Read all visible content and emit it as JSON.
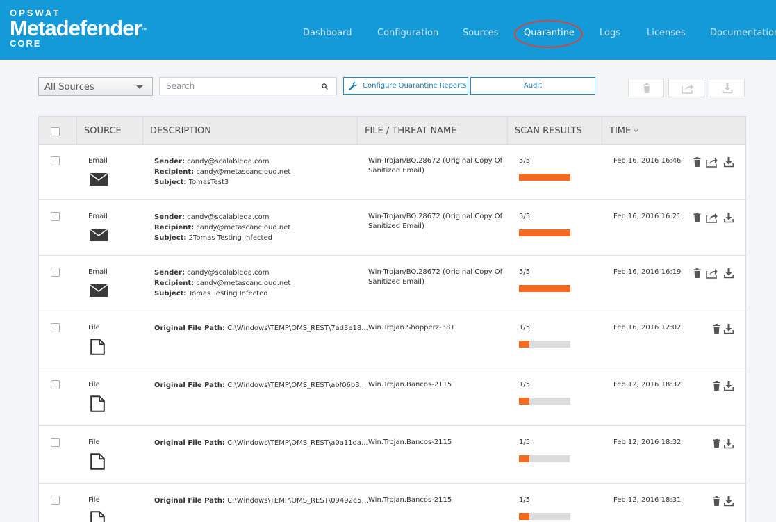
{
  "header": {
    "brand": "OPSWAT",
    "product": "Metadefender",
    "trademark": "™",
    "edition": "CORE",
    "nav": [
      {
        "label": "Dashboard",
        "active": false
      },
      {
        "label": "Configuration",
        "active": false
      },
      {
        "label": "Sources",
        "active": false
      },
      {
        "label": "Quarantine",
        "active": true
      },
      {
        "label": "Logs",
        "active": false
      },
      {
        "label": "Licenses",
        "active": false
      },
      {
        "label": "Documentation",
        "active": false
      }
    ]
  },
  "toolbar": {
    "source_filter": "All Sources",
    "search_placeholder": "Search",
    "configure_reports_label": "Configure Quarantine Reports",
    "audit_label": "Audit",
    "bulk_actions": [
      "trash-icon",
      "share-icon",
      "download-icon"
    ]
  },
  "table": {
    "columns": [
      "SOURCE",
      "DESCRIPTION",
      "FILE / THREAT NAME",
      "SCAN RESULTS",
      "TIME"
    ],
    "rows": [
      {
        "source": "Email",
        "icon": "envelope-icon",
        "details": [
          {
            "label": "Sender:",
            "value": "candy@scalableqa.com"
          },
          {
            "label": "Recipient:",
            "value": "candy@metascancloud.net"
          },
          {
            "label": "Subject:",
            "value": "TomasTest3"
          }
        ],
        "threat": "Win-Trojan/BO.28672 (Original Copy Of Sanitized Email)",
        "score": "5/5",
        "detection_ratio": 1.0,
        "time": "Feb 16, 2016 16:46",
        "actions": [
          "trash-icon",
          "share-icon",
          "download-icon"
        ]
      },
      {
        "source": "Email",
        "icon": "envelope-icon",
        "details": [
          {
            "label": "Sender:",
            "value": "candy@scalableqa.com"
          },
          {
            "label": "Recipient:",
            "value": "candy@metascancloud.net"
          },
          {
            "label": "Subject:",
            "value": "2Tomas Testing Infected"
          }
        ],
        "threat": "Win-Trojan/BO.28672 (Original Copy Of Sanitized Email)",
        "score": "5/5",
        "detection_ratio": 1.0,
        "time": "Feb 16, 2016 16:21",
        "actions": [
          "trash-icon",
          "share-icon",
          "download-icon"
        ]
      },
      {
        "source": "Email",
        "icon": "envelope-icon",
        "details": [
          {
            "label": "Sender:",
            "value": "candy@scalableqa.com"
          },
          {
            "label": "Recipient:",
            "value": "candy@metascancloud.net"
          },
          {
            "label": "Subject:",
            "value": "Tomas Testing Infected"
          }
        ],
        "threat": "Win-Trojan/BO.28672 (Original Copy Of Sanitized Email)",
        "score": "5/5",
        "detection_ratio": 1.0,
        "time": "Feb 16, 2016 16:19",
        "actions": [
          "trash-icon",
          "share-icon",
          "download-icon"
        ]
      },
      {
        "source": "File",
        "icon": "file-icon",
        "details": [
          {
            "label": "Original File Path:",
            "value": "C:\\Windows\\TEMP\\OMS_REST\\7ad3e18..."
          }
        ],
        "threat": "Win.Trojan.Shopperz-381",
        "score": "1/5",
        "detection_ratio": 0.2,
        "time": "Feb 16, 2016 12:02",
        "actions": [
          "trash-icon",
          "download-icon"
        ]
      },
      {
        "source": "File",
        "icon": "file-icon",
        "details": [
          {
            "label": "Original File Path:",
            "value": "C:\\Windows\\TEMP\\OMS_REST\\abf06b3..."
          }
        ],
        "threat": "Win.Trojan.Bancos-2115",
        "score": "1/5",
        "detection_ratio": 0.2,
        "time": "Feb 12, 2016 18:32",
        "actions": [
          "trash-icon",
          "download-icon"
        ]
      },
      {
        "source": "File",
        "icon": "file-icon",
        "details": [
          {
            "label": "Original File Path:",
            "value": "C:\\Windows\\TEMP\\OMS_REST\\a0a11da..."
          }
        ],
        "threat": "Win.Trojan.Bancos-2115",
        "score": "1/5",
        "detection_ratio": 0.2,
        "time": "Feb 12, 2016 18:32",
        "actions": [
          "trash-icon",
          "download-icon"
        ]
      },
      {
        "source": "File",
        "icon": "file-icon",
        "details": [
          {
            "label": "Original File Path:",
            "value": "C:\\Windows\\TEMP\\OMS_REST\\09492e5..."
          }
        ],
        "threat": "Win.Trojan.Bancos-2115",
        "score": "1/5",
        "detection_ratio": 0.2,
        "time": "Feb 12, 2016 18:31",
        "actions": [
          "trash-icon",
          "download-icon"
        ]
      }
    ]
  },
  "colors": {
    "header_bg": "#149ad8",
    "accent": "#1a8ccb",
    "threat_bar": "#f36b21",
    "highlight_ring": "#d8443a"
  }
}
